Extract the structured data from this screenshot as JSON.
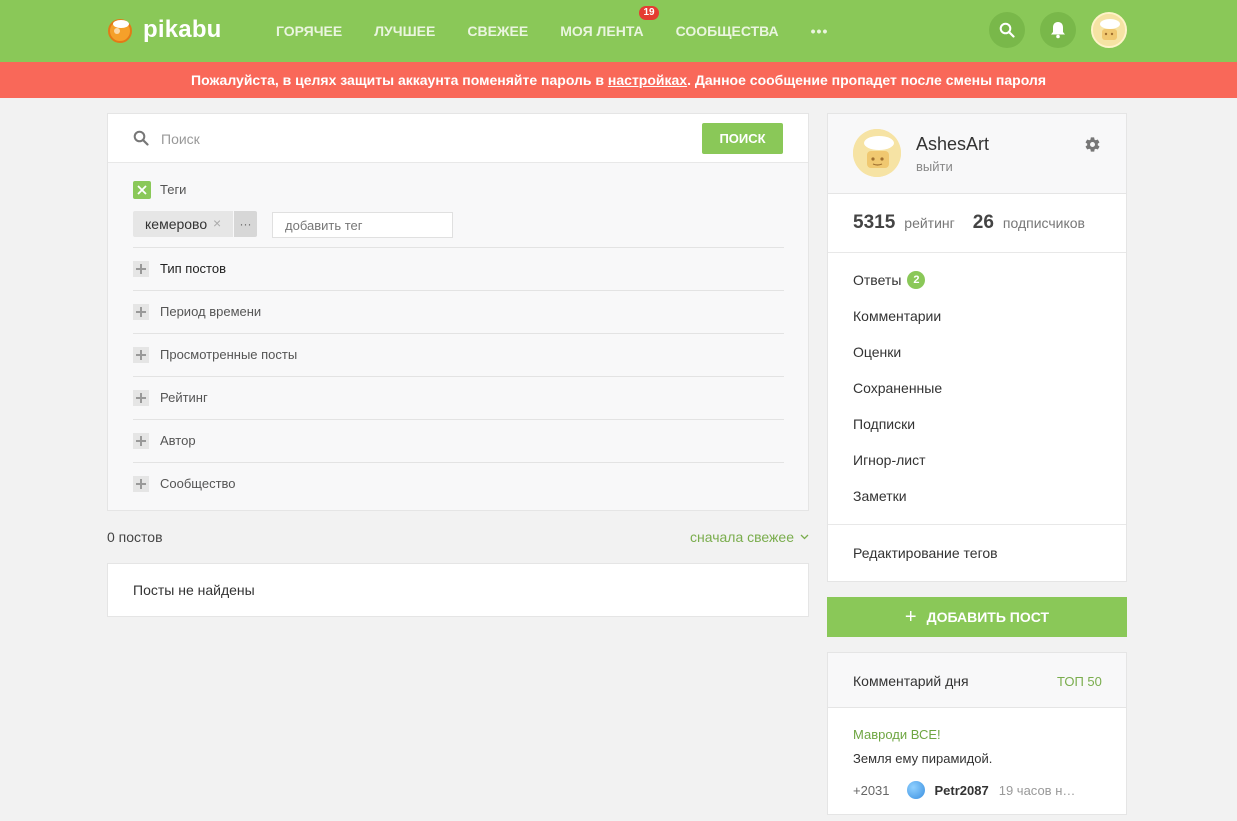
{
  "header": {
    "logo_text": "pikabu",
    "nav": [
      {
        "label": "ГОРЯЧЕЕ"
      },
      {
        "label": "ЛУЧШЕЕ"
      },
      {
        "label": "СВЕЖЕЕ"
      },
      {
        "label": "МОЯ ЛЕНТА",
        "badge": "19"
      },
      {
        "label": "СООБЩЕСТВА"
      }
    ],
    "more_label": "•••"
  },
  "alert": {
    "prefix": "Пожалуйста, в целях защиты аккаунта поменяйте пароль в ",
    "link": "настройках",
    "suffix": ". Данное сообщение пропадет после смены пароля"
  },
  "search": {
    "placeholder": "Поиск",
    "button": "ПОИСК",
    "tags_label": "Теги",
    "tag_chip": "кемерово",
    "tag_chip_remove": "×",
    "tag_chip_more": "···",
    "tag_input_placeholder": "добавить тег",
    "filters": [
      "Тип постов",
      "Период времени",
      "Просмотренные посты",
      "Рейтинг",
      "Автор",
      "Сообщество"
    ]
  },
  "results": {
    "count": "0 постов",
    "sort": "сначала свежее",
    "empty": "Посты не найдены"
  },
  "profile": {
    "name": "AshesArt",
    "logout": "выйти",
    "rating_value": "5315",
    "rating_label": "рейтинг",
    "subs_value": "26",
    "subs_label": "подписчиков",
    "menu": [
      {
        "label": "Ответы",
        "badge": "2"
      },
      {
        "label": "Комментарии"
      },
      {
        "label": "Оценки"
      },
      {
        "label": "Сохраненные"
      },
      {
        "label": "Подписки"
      },
      {
        "label": "Игнор-лист"
      },
      {
        "label": "Заметки"
      }
    ],
    "edit_tags": "Редактирование тегов"
  },
  "add_post": {
    "plus": "+",
    "label": "ДОБАВИТЬ ПОСТ"
  },
  "comment_of_day": {
    "title": "Комментарий дня",
    "top_link": "ТОП 50",
    "post_title": "Мавроди ВСЕ!",
    "text": "Земля ему пирамидой.",
    "rating": "+2031",
    "user": "Petr2087",
    "time": "19 часов н…"
  },
  "colors": {
    "brand_green": "#8ac858",
    "alert_red": "#f96859",
    "link_green": "#7aad4d"
  },
  "icons": [
    "logo-icon",
    "search-icon",
    "bell-icon",
    "gear-icon",
    "close-icon",
    "plus-icon",
    "chevron-down-icon"
  ]
}
